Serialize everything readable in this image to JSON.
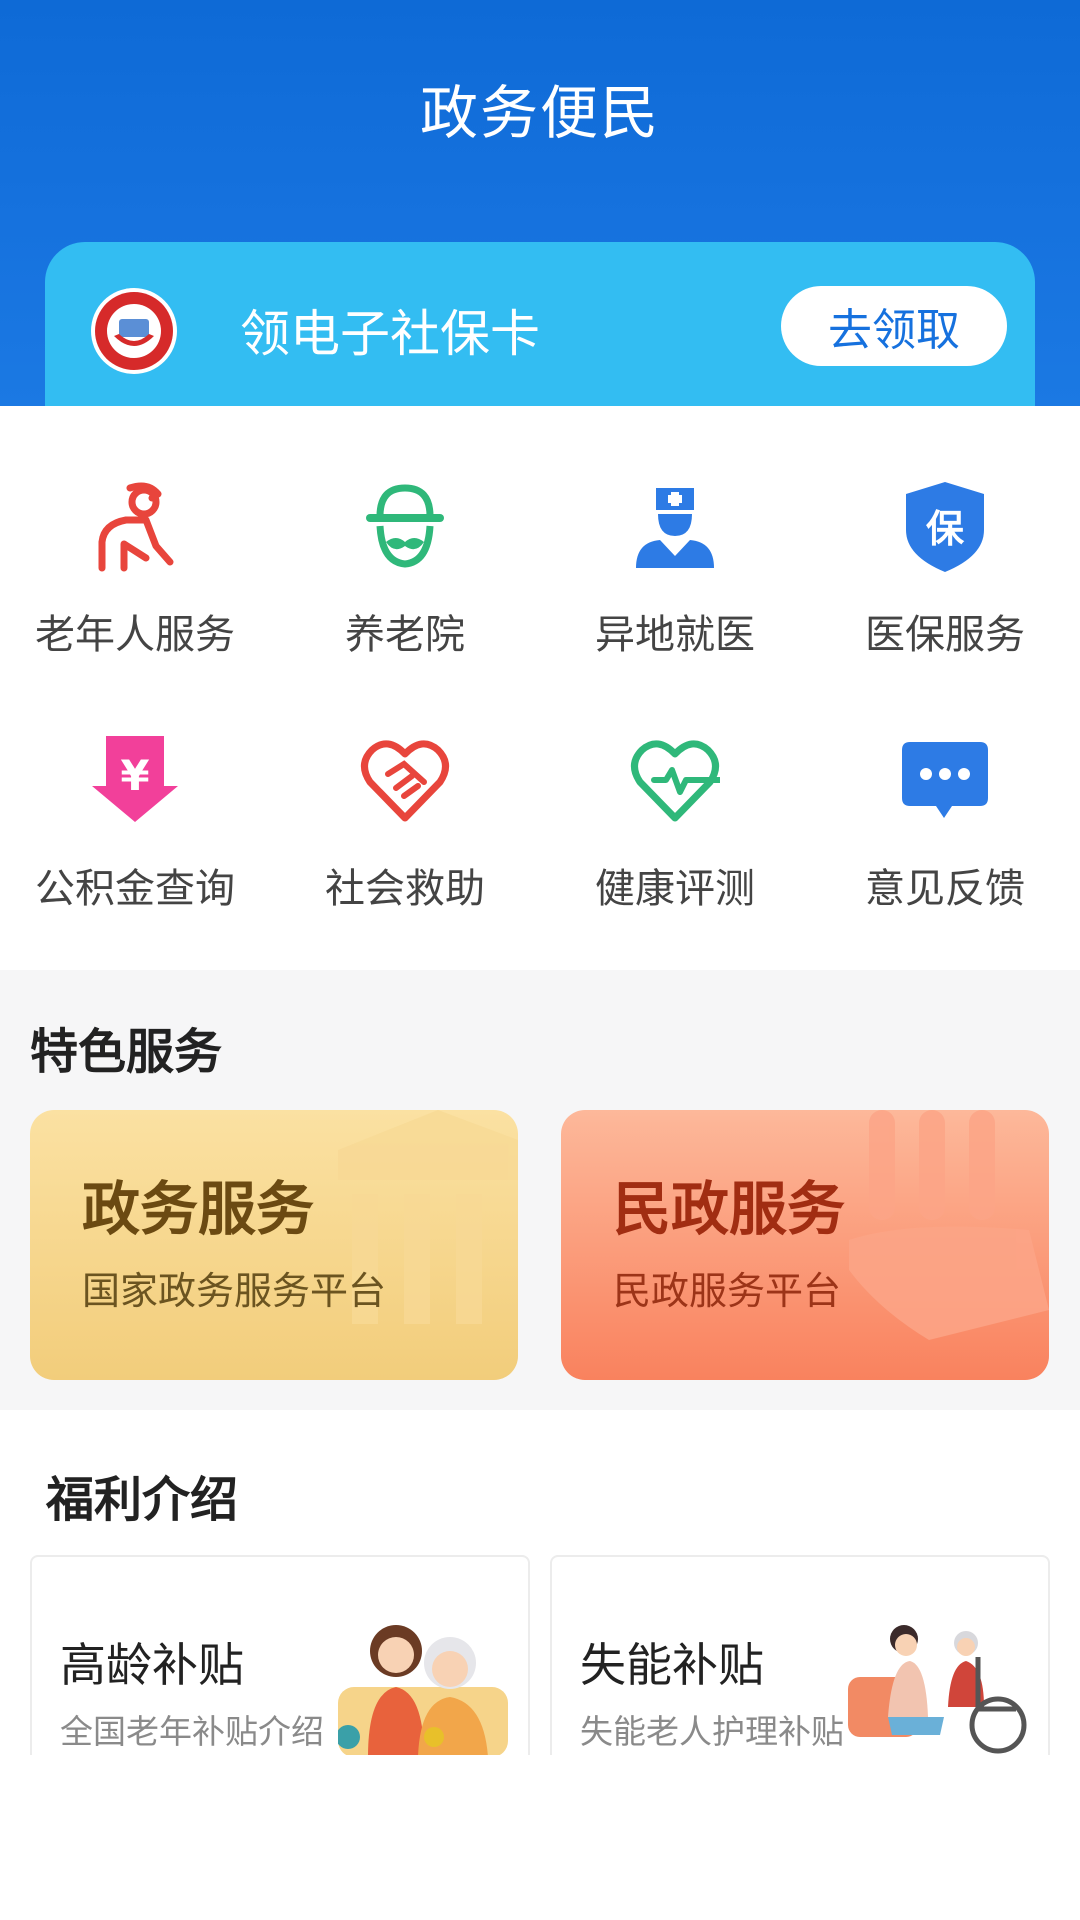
{
  "header": {
    "title": "政务便民"
  },
  "banner": {
    "text": "领电子社保卡",
    "button": "去领取"
  },
  "services": [
    {
      "label": "老年人服务",
      "icon": "elderly-person-icon"
    },
    {
      "label": "养老院",
      "icon": "elder-mustache-icon"
    },
    {
      "label": "异地就医",
      "icon": "doctor-icon"
    },
    {
      "label": "医保服务",
      "icon": "insurance-shield-icon"
    },
    {
      "label": "公积金查询",
      "icon": "yuan-download-icon"
    },
    {
      "label": "社会救助",
      "icon": "handshake-heart-icon"
    },
    {
      "label": "健康评测",
      "icon": "heart-pulse-icon"
    },
    {
      "label": "意见反馈",
      "icon": "chat-bubble-icon"
    }
  ],
  "shield_char": "保",
  "yuan_char": "¥",
  "featured": {
    "title": "特色服务",
    "cards": [
      {
        "title": "政务服务",
        "subtitle": "国家政务服务平台"
      },
      {
        "title": "民政服务",
        "subtitle": "民政服务平台"
      }
    ]
  },
  "welfare": {
    "title": "福利介绍",
    "cards": [
      {
        "title": "高龄补贴",
        "subtitle": "全国老年补贴介绍"
      },
      {
        "title": "失能补贴",
        "subtitle": "失能老人护理补贴"
      }
    ]
  },
  "colors": {
    "header_blue": "#1672de",
    "banner_cyan": "#33bdf2",
    "icon_red": "#e8453c",
    "icon_green": "#2fb87a",
    "icon_blue": "#2d7be5",
    "icon_pink": "#f2409a"
  }
}
